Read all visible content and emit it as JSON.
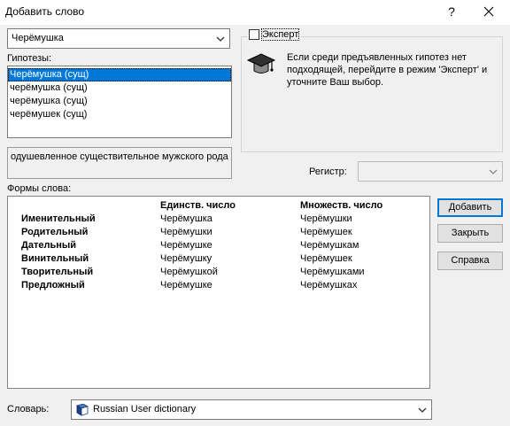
{
  "window": {
    "title": "Добавить слово",
    "help_glyph": "?",
    "close_glyph": "✕"
  },
  "word_combo": {
    "value": "Черёмушка"
  },
  "hypotheses": {
    "label": "Гипотезы:",
    "items": [
      "Черёмушка  (сущ)",
      "черёмушка  (сущ)",
      "черёмушка  (сущ)",
      "черёмушек  (сущ)"
    ],
    "selected_index": 0
  },
  "description": "одушевленное существительное мужского рода",
  "expert": {
    "checkbox_label": "Эксперт",
    "checked": false,
    "hint": "Если среди предъявленных гипотез нет подходящей, перейдите в режим 'Эксперт' и уточните Ваш выбор.",
    "icon": "graduation-cap-icon"
  },
  "register": {
    "label": "Регистр:",
    "value": ""
  },
  "forms": {
    "label": "Формы слова:",
    "headers": {
      "singular": "Единств. число",
      "plural": "Множеств. число"
    },
    "rows": [
      {
        "case": "Именительный",
        "singular": "Черёмушка",
        "plural": "Черёмушки"
      },
      {
        "case": "Родительный",
        "singular": "Черёмушки",
        "plural": "Черёмушек"
      },
      {
        "case": "Дательный",
        "singular": "Черёмушке",
        "plural": "Черёмушкам"
      },
      {
        "case": "Винительный",
        "singular": "Черёмушку",
        "plural": "Черёмушек"
      },
      {
        "case": "Творительный",
        "singular": "Черёмушкой",
        "plural": "Черёмушками"
      },
      {
        "case": "Предложный",
        "singular": "Черёмушке",
        "plural": "Черёмушках"
      }
    ]
  },
  "buttons": {
    "add": "Добавить",
    "close": "Закрыть",
    "help": "Справка"
  },
  "dictionary": {
    "label": "Словарь:",
    "value": "Russian User dictionary",
    "icon": "book-icon"
  },
  "colors": {
    "selection": "#0078d7",
    "background": "#f0f0f0"
  }
}
